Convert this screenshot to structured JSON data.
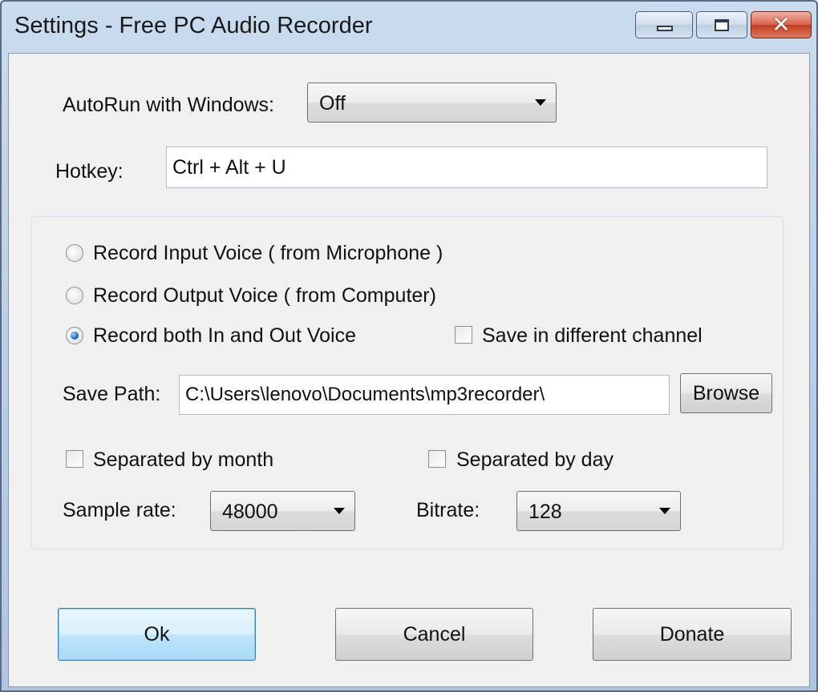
{
  "window": {
    "title": "Settings - Free PC Audio Recorder",
    "controls": {
      "close_glyph": "✕"
    }
  },
  "autorun": {
    "label": "AutoRun with Windows:",
    "value": "Off"
  },
  "hotkey": {
    "label": "Hotkey:",
    "value": "Ctrl + Alt + U"
  },
  "record": {
    "options": [
      {
        "label": "Record Input Voice ( from Microphone )",
        "checked": false
      },
      {
        "label": "Record Output Voice ( from Computer)",
        "checked": false
      },
      {
        "label": "Record both In and Out Voice",
        "checked": true
      }
    ],
    "different_channel": {
      "label": "Save in different channel",
      "checked": false
    }
  },
  "save_path": {
    "label": "Save Path:",
    "value": "C:\\Users\\lenovo\\Documents\\mp3recorder\\",
    "browse_label": "Browse"
  },
  "separation": {
    "by_month": {
      "label": "Separated by month",
      "checked": false
    },
    "by_day": {
      "label": "Separated by day",
      "checked": false
    }
  },
  "sample_rate": {
    "label": "Sample rate:",
    "value": "48000"
  },
  "bitrate": {
    "label": "Bitrate:",
    "value": "128"
  },
  "buttons": {
    "ok": "Ok",
    "cancel": "Cancel",
    "donate": "Donate"
  }
}
